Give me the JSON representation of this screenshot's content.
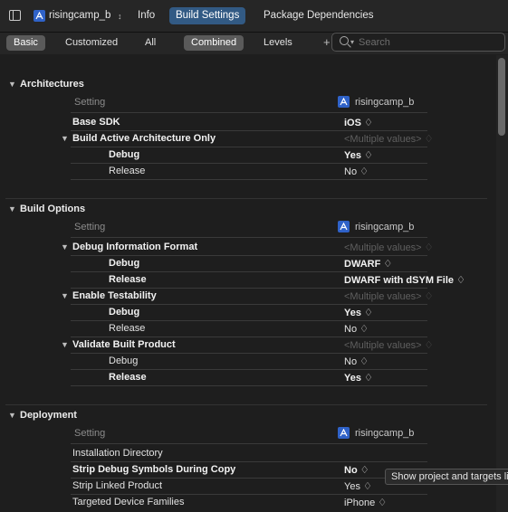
{
  "toolbar": {
    "project_name": "risingcamp_b",
    "tabs": [
      "Info",
      "Build Settings",
      "Package Dependencies"
    ]
  },
  "filter": {
    "scope": [
      "Basic",
      "Customized",
      "All"
    ],
    "view": [
      "Combined",
      "Levels"
    ],
    "add": "+",
    "search_placeholder": "Search"
  },
  "sections": [
    {
      "title": "Architectures",
      "column_setting": "Setting",
      "column_target": "risingcamp_b",
      "rows": [
        {
          "label": "Base SDK",
          "value": "iOS ♢"
        },
        {
          "label": "Build Active Architecture Only",
          "value": "<Multiple values> ♢"
        },
        {
          "label": "Debug",
          "value": "Yes ♢"
        },
        {
          "label": "Release",
          "value": "No ♢"
        }
      ]
    },
    {
      "title": "Build Options",
      "column_setting": "Setting",
      "column_target": "risingcamp_b",
      "rows": [
        {
          "label": "Debug Information Format",
          "value": "<Multiple values> ♢"
        },
        {
          "label": "Debug",
          "value": "DWARF ♢"
        },
        {
          "label": "Release",
          "value": "DWARF with dSYM File ♢"
        },
        {
          "label": "Enable Testability",
          "value": "<Multiple values> ♢"
        },
        {
          "label": "Debug",
          "value": "Yes ♢"
        },
        {
          "label": "Release",
          "value": "No ♢"
        },
        {
          "label": "Validate Built Product",
          "value": "<Multiple values> ♢"
        },
        {
          "label": "Debug",
          "value": "No ♢"
        },
        {
          "label": "Release",
          "value": "Yes ♢"
        }
      ]
    },
    {
      "title": "Deployment",
      "column_setting": "Setting",
      "column_target": "risingcamp_b",
      "rows": [
        {
          "label": "Installation Directory",
          "value": ""
        },
        {
          "label": "Strip Debug Symbols During Copy",
          "value": "No ♢"
        },
        {
          "label": "Strip Linked Product",
          "value": "Yes ♢"
        },
        {
          "label": "Targeted Device Families",
          "value": "iPhone ♢"
        }
      ]
    }
  ],
  "tooltip": "Show project and targets list"
}
